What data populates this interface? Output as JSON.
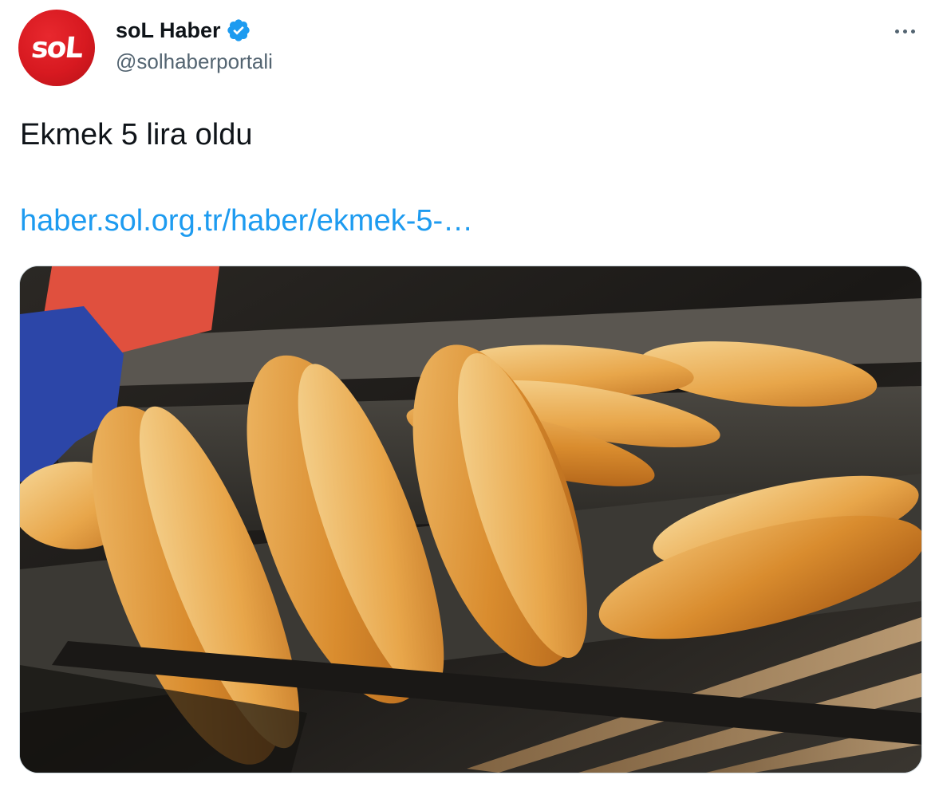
{
  "tweet": {
    "avatar_text": "soL",
    "display_name": "soL Haber",
    "handle": "@solhaberportali",
    "text": "Ekmek 5 lira oldu",
    "link": "haber.sol.org.tr/haber/ekmek-5-…",
    "media_description_icon": "bread-photo"
  },
  "colors": {
    "brand_red": "#d71920",
    "link_blue": "#1d9bf0",
    "verified_blue": "#1d9bf0",
    "secondary_text": "#536471"
  }
}
